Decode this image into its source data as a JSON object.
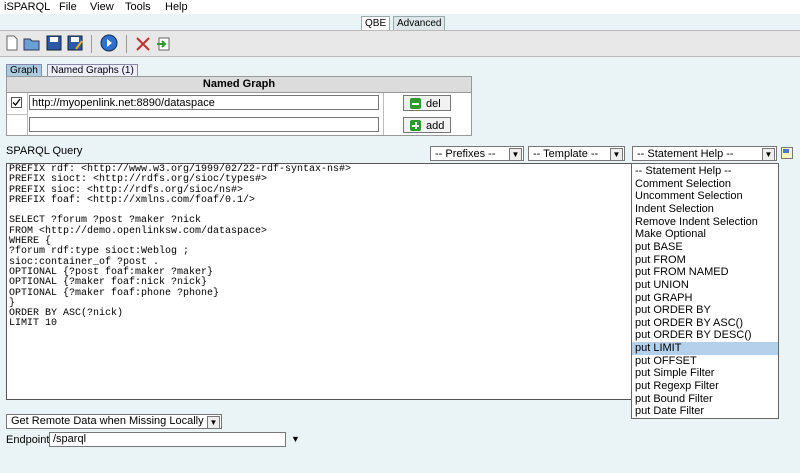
{
  "menubar": {
    "app_name": "iSPARQL",
    "items": [
      "File",
      "View",
      "Tools",
      "Help"
    ]
  },
  "mode_tabs": [
    "QBE",
    "Advanced"
  ],
  "toolbar": {
    "icons": [
      "new-file-icon",
      "open-folder-icon",
      "save-icon",
      "save-as-icon",
      "run-query-icon",
      "clear-icon",
      "load-icon"
    ]
  },
  "graph_tabs": {
    "graph": "Graph",
    "named_graphs": "Named Graphs (1)"
  },
  "named_graph_table": {
    "header": "Named Graph",
    "rows": [
      {
        "checked": true,
        "value": "http://myopenlink.net:8890/dataspace",
        "button": "del"
      },
      {
        "checked": false,
        "value": "",
        "button": "add"
      }
    ]
  },
  "query": {
    "label": "SPARQL Query",
    "prefixes_select": "-- Prefixes --",
    "template_select": "-- Template --",
    "statement_help_select": "-- Statement Help --",
    "text": "PREFIX rdf: <http://www.w3.org/1999/02/22-rdf-syntax-ns#>\nPREFIX sioct: <http://rdfs.org/sioc/types#>\nPREFIX sioc: <http://rdfs.org/sioc/ns#>\nPREFIX foaf: <http://xmlns.com/foaf/0.1/>\n\nSELECT ?forum ?post ?maker ?nick\nFROM <http://demo.openlinksw.com/dataspace>\nWHERE {\n?forum rdf:type sioct:Weblog ;\nsioc:container_of ?post .\nOPTIONAL {?post foaf:maker ?maker}\nOPTIONAL {?maker foaf:nick ?nick}\nOPTIONAL {?maker foaf:phone ?phone}\n}\nORDER BY ASC(?nick)\nLIMIT 10"
  },
  "statement_help_options": [
    "-- Statement Help --",
    "Comment Selection",
    "Uncomment Selection",
    "Indent Selection",
    "Remove Indent Selection",
    "Make Optional",
    "put BASE",
    "put FROM",
    "put FROM NAMED",
    "put UNION",
    "put GRAPH",
    "put ORDER BY",
    "put ORDER BY ASC()",
    "put ORDER BY DESC()",
    "put LIMIT",
    "put OFFSET",
    "put Simple Filter",
    "put Regexp Filter",
    "put Bound Filter",
    "put Date Filter"
  ],
  "highlighted_option": "put LIMIT",
  "remote_data_select": "Get Remote Data when Missing Locally",
  "endpoint": {
    "label": "Endpoint",
    "value": "/sparql"
  }
}
